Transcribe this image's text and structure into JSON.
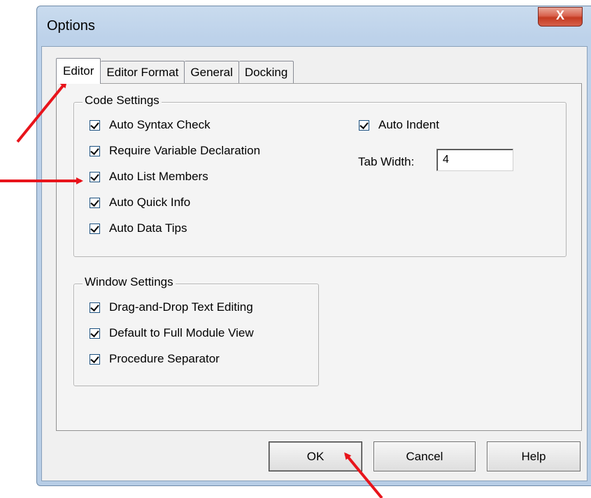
{
  "window": {
    "title": "Options",
    "close_label": "X"
  },
  "tabs": [
    {
      "label": "Editor",
      "active": true
    },
    {
      "label": "Editor Format",
      "active": false
    },
    {
      "label": "General",
      "active": false
    },
    {
      "label": "Docking",
      "active": false
    }
  ],
  "code_settings": {
    "legend": "Code Settings",
    "options": [
      {
        "label": "Auto Syntax Check",
        "checked": true
      },
      {
        "label": "Require Variable Declaration",
        "checked": true
      },
      {
        "label": "Auto List Members",
        "checked": true
      },
      {
        "label": "Auto Quick Info",
        "checked": true
      },
      {
        "label": "Auto Data Tips",
        "checked": true
      }
    ],
    "auto_indent": {
      "label": "Auto Indent",
      "checked": true
    },
    "tab_width": {
      "label": "Tab Width:",
      "value": "4"
    }
  },
  "window_settings": {
    "legend": "Window Settings",
    "options": [
      {
        "label": "Drag-and-Drop Text Editing",
        "checked": true
      },
      {
        "label": "Default to Full Module View",
        "checked": true
      },
      {
        "label": "Procedure Separator",
        "checked": true
      }
    ]
  },
  "buttons": {
    "ok": "OK",
    "cancel": "Cancel",
    "help": "Help"
  },
  "annotation_color": "#e8141b"
}
